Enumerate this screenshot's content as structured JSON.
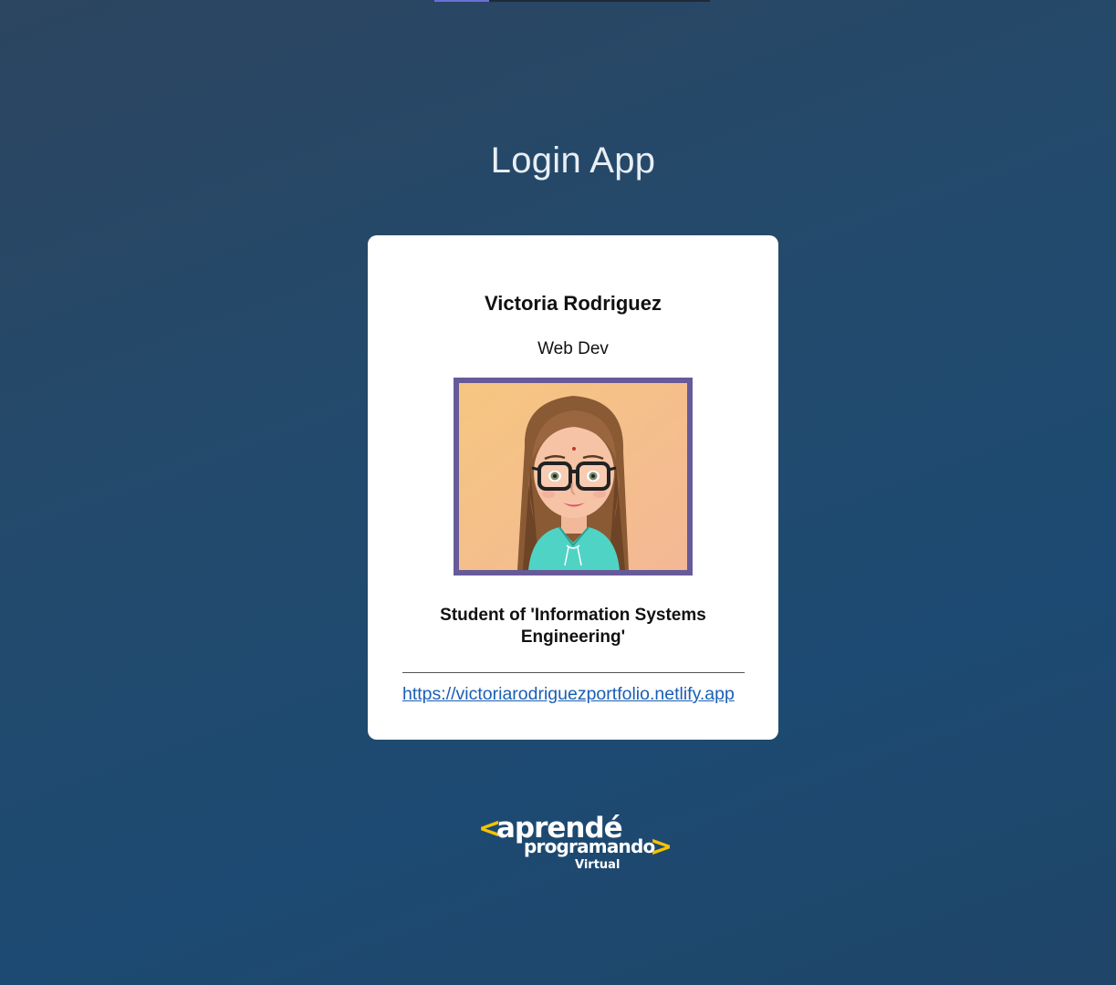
{
  "page": {
    "title": "Login App"
  },
  "loading_bar": {
    "progress_fraction": 0.2
  },
  "profile_card": {
    "name": "Victoria Rodriguez",
    "role": "Web Dev",
    "description": "Student of 'Information Systems Engineering'",
    "portfolio_url": "https://victoriarodriguezportfolio.netlify.app",
    "avatar_icon": "cartoon-avatar-woman-glasses"
  },
  "footer_logo": {
    "line1": "aprendé",
    "line2": "programando",
    "line3": "Virtual",
    "left_chevron": "<",
    "right_chevron": ">"
  },
  "colors": {
    "background": "#1f4a70",
    "card": "#ffffff",
    "avatar_border": "#675a98",
    "link": "#1a5fb4",
    "logo_accent": "#f5c400",
    "loading_bar": "#6a6fd6"
  }
}
